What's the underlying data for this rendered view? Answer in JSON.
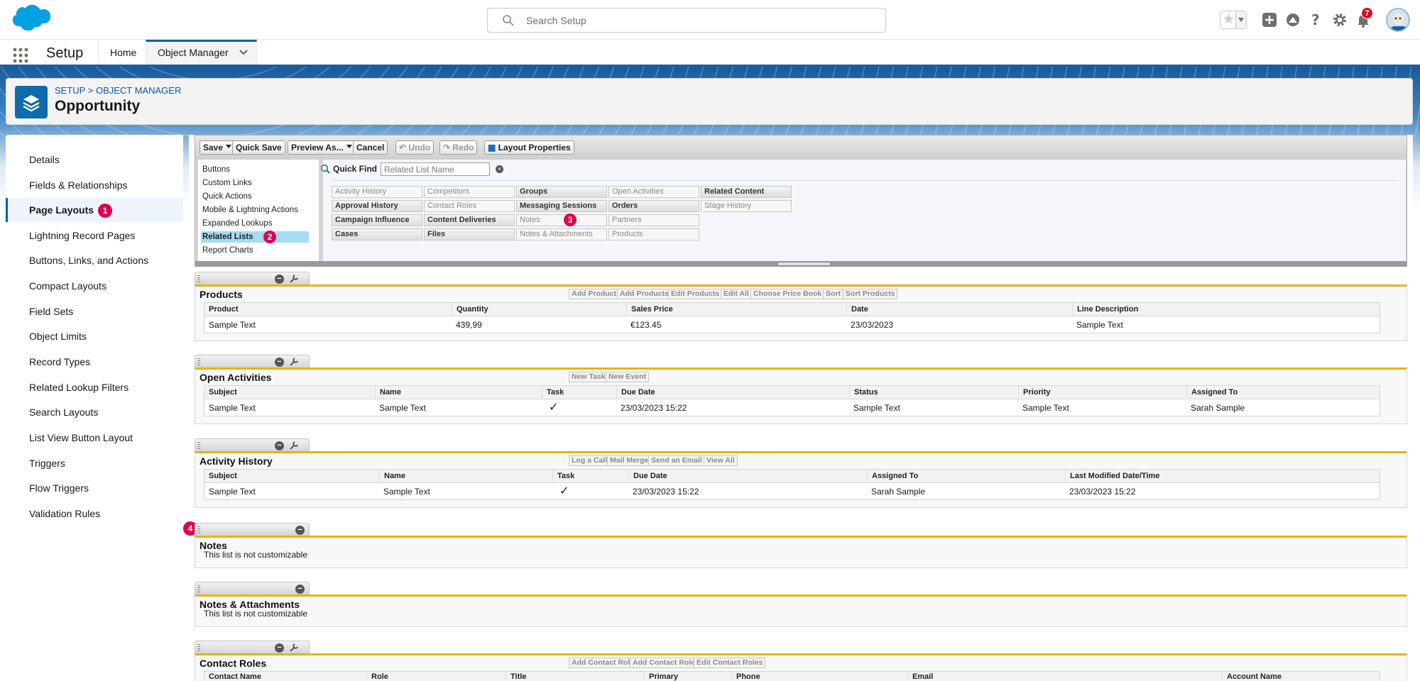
{
  "header": {
    "search_placeholder": "Search Setup",
    "notification_count": "7",
    "icons": [
      "salesforce-cloud-logo",
      "search-icon",
      "star-icon",
      "plus-icon",
      "trailhead-icon",
      "help-icon",
      "gear-icon",
      "bell-icon",
      "avatar"
    ]
  },
  "nav": {
    "app_title": "Setup",
    "tabs": [
      {
        "label": "Home"
      },
      {
        "label": "Object Manager"
      }
    ]
  },
  "object_header": {
    "breadcrumb": [
      "SETUP",
      "OBJECT MANAGER"
    ],
    "breadcrumb_sep": ">",
    "title": "Opportunity"
  },
  "sidebar": {
    "items": [
      {
        "label": "Details"
      },
      {
        "label": "Fields & Relationships"
      },
      {
        "label": "Page Layouts",
        "badge": "1"
      },
      {
        "label": "Lightning Record Pages"
      },
      {
        "label": "Buttons, Links, and Actions"
      },
      {
        "label": "Compact Layouts"
      },
      {
        "label": "Field Sets"
      },
      {
        "label": "Object Limits"
      },
      {
        "label": "Record Types"
      },
      {
        "label": "Related Lookup Filters"
      },
      {
        "label": "Search Layouts"
      },
      {
        "label": "List View Button Layout"
      },
      {
        "label": "Triggers"
      },
      {
        "label": "Flow Triggers"
      },
      {
        "label": "Validation Rules"
      }
    ]
  },
  "toolbar": {
    "save": "Save",
    "quick_save": "Quick Save",
    "preview": "Preview As...",
    "cancel": "Cancel",
    "undo": "Undo",
    "redo": "Redo",
    "layout_properties": "Layout Properties"
  },
  "palette": {
    "categories": [
      {
        "label": "Buttons"
      },
      {
        "label": "Custom Links"
      },
      {
        "label": "Quick Actions"
      },
      {
        "label": "Mobile & Lightning Actions"
      },
      {
        "label": "Expanded Lookups"
      },
      {
        "label": "Related Lists",
        "badge": "2"
      },
      {
        "label": "Report Charts"
      }
    ],
    "quick_find_label": "Quick Find",
    "quick_find_placeholder": "Related List Name",
    "items": [
      [
        {
          "label": "Activity History"
        },
        {
          "label": "Approval History"
        },
        {
          "label": "Campaign Influence"
        },
        {
          "label": "Cases"
        }
      ],
      [
        {
          "label": "Competitors"
        },
        {
          "label": "Contact Roles"
        },
        {
          "label": "Content Deliveries"
        },
        {
          "label": "Files"
        }
      ],
      [
        {
          "label": "Groups"
        },
        {
          "label": "Messaging Sessions"
        },
        {
          "label": "Notes",
          "badge": "3"
        },
        {
          "label": "Notes & Attachments"
        }
      ],
      [
        {
          "label": "Open Activities"
        },
        {
          "label": "Orders"
        },
        {
          "label": "Partners"
        },
        {
          "label": "Products"
        }
      ],
      [
        {
          "label": "Related Content"
        },
        {
          "label": "Stage History"
        }
      ]
    ]
  },
  "related_lists": {
    "products": {
      "title": "Products",
      "buttons": [
        "Add Product",
        "Add Products",
        "Edit Products",
        "Edit All",
        "Choose Price Book",
        "Sort",
        "Sort Products"
      ],
      "columns": [
        "Product",
        "Quantity",
        "Sales Price",
        "Date",
        "Line Description"
      ],
      "row": [
        "Sample Text",
        "439,99",
        "€123.45",
        "23/03/2023",
        "Sample Text"
      ]
    },
    "open_activities": {
      "title": "Open Activities",
      "buttons": [
        "New Task",
        "New Event"
      ],
      "columns": [
        "Subject",
        "Name",
        "Task",
        "Due Date",
        "Status",
        "Priority",
        "Assigned To"
      ],
      "row": [
        "Sample Text",
        "Sample Text",
        "✓",
        "23/03/2023 15:22",
        "Sample Text",
        "Sample Text",
        "Sarah Sample"
      ]
    },
    "activity_history": {
      "title": "Activity History",
      "buttons": [
        "Log a Call",
        "Mail Merge",
        "Send an Email",
        "View All"
      ],
      "columns": [
        "Subject",
        "Name",
        "Task",
        "Due Date",
        "Assigned To",
        "Last Modified Date/Time"
      ],
      "row": [
        "Sample Text",
        "Sample Text",
        "✓",
        "23/03/2023 15:22",
        "Sarah Sample",
        "23/03/2023 15:22"
      ]
    },
    "notes": {
      "title": "Notes",
      "message": "This list is not customizable",
      "badge": "4"
    },
    "notes_attachments": {
      "title": "Notes & Attachments",
      "message": "This list is not customizable"
    },
    "contact_roles": {
      "title": "Contact Roles",
      "buttons": [
        "Add Contact Role",
        "Add Contact Roles",
        "Edit Contact Roles"
      ],
      "columns": [
        "Contact Name",
        "Role",
        "Title",
        "Primary",
        "Phone",
        "Email",
        "Account Name"
      ]
    }
  },
  "colors": {
    "brand": "#0b5cab",
    "nav_band": "#175a9a",
    "section_accent": "#e8b30d",
    "badge": "#e0004d"
  }
}
